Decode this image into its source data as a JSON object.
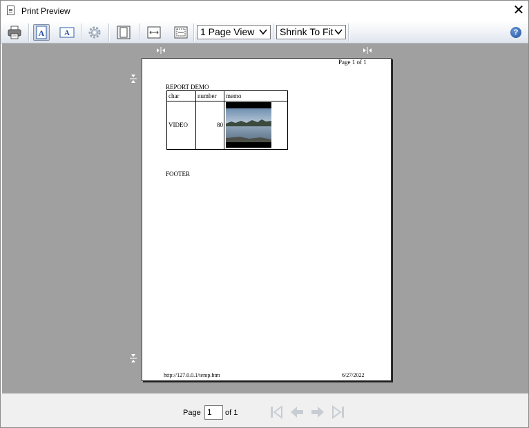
{
  "window": {
    "title": "Print Preview",
    "close_glyph": "✕"
  },
  "toolbar": {
    "buttons": [
      {
        "name": "print-button",
        "icon": "printer-icon"
      },
      {
        "name": "portrait-button",
        "icon": "portrait-icon",
        "pressed": true
      },
      {
        "name": "landscape-button",
        "icon": "landscape-icon"
      },
      {
        "name": "page-setup-button",
        "icon": "gear-icon"
      },
      {
        "name": "fit-page-button",
        "icon": "fit-page-icon"
      },
      {
        "name": "fit-width-button",
        "icon": "fit-width-icon"
      },
      {
        "name": "fit-both-button",
        "icon": "fit-both-icon"
      }
    ],
    "view_select": {
      "value": "1 Page View"
    },
    "scale_select": {
      "value": "Shrink To Fit"
    },
    "help_glyph": "?"
  },
  "page": {
    "header_right": "Page 1 of 1",
    "report_title": "REPORT DEMO",
    "table": {
      "headers": [
        "char",
        "number",
        "memo"
      ],
      "rows": [
        {
          "char": "VIDEO",
          "number": "80",
          "memo": "lake-landscape-image"
        }
      ]
    },
    "footer_label": "FOOTER",
    "footer_url": "http://127.0.0.1/temp.htm",
    "footer_date": "6/27/2022"
  },
  "statusbar": {
    "page_label": "Page",
    "page_value": "1",
    "of_label": "of 1"
  },
  "colors": {
    "preview_bg": "#a0a0a0",
    "nav_disabled": "#c8cdd4",
    "accent": "#1f4f9c"
  }
}
